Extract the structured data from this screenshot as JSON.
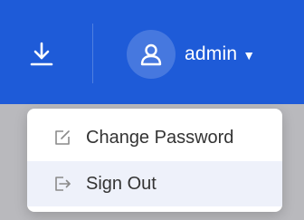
{
  "header": {
    "icons": {
      "download": "download-icon",
      "user": "user-icon",
      "caret": "caret-down-icon"
    },
    "username": "admin",
    "caret_glyph": "▼",
    "colors": {
      "bar": "#1e5bd8",
      "avatar_bg": "rgba(255,255,255,0.18)",
      "text": "#ffffff"
    }
  },
  "dropdown": {
    "items": [
      {
        "label": "Change Password",
        "icon": "edit-icon"
      },
      {
        "label": "Sign Out",
        "icon": "sign-out-icon",
        "highlighted": true
      }
    ],
    "colors": {
      "background": "#ffffff",
      "hover": "#eef1fa",
      "text": "#333333",
      "icon": "#8a8a8a"
    }
  }
}
